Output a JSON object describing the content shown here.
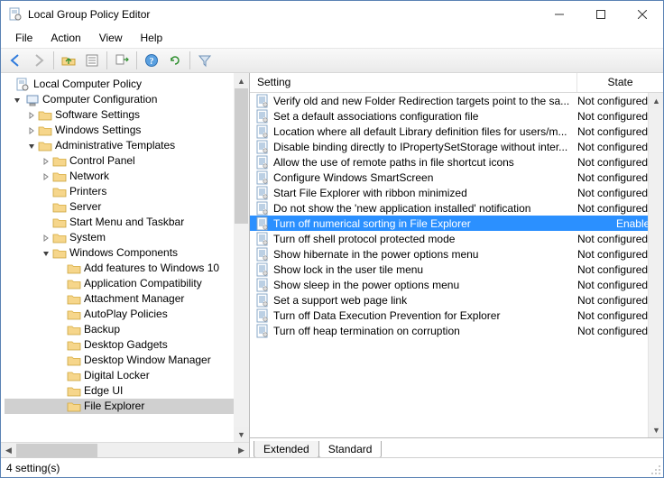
{
  "window_title": "Local Group Policy Editor",
  "menus": [
    "File",
    "Action",
    "View",
    "Help"
  ],
  "columns": {
    "setting": "Setting",
    "state": "State"
  },
  "tabs": {
    "extended": "Extended",
    "standard": "Standard"
  },
  "status": "4 setting(s)",
  "tree": {
    "root": "Local Computer Policy",
    "computer_config": "Computer Configuration",
    "software_settings": "Software Settings",
    "windows_settings": "Windows Settings",
    "admin_templates": "Administrative Templates",
    "control_panel": "Control Panel",
    "network": "Network",
    "printers": "Printers",
    "server": "Server",
    "start_menu": "Start Menu and Taskbar",
    "system": "System",
    "windows_components": "Windows Components",
    "wc": {
      "add_features": "Add features to Windows 10",
      "app_compat": "Application Compatibility",
      "attachment_mgr": "Attachment Manager",
      "autoplay": "AutoPlay Policies",
      "backup": "Backup",
      "desktop_gadgets": "Desktop Gadgets",
      "dwm": "Desktop Window Manager",
      "digital_locker": "Digital Locker",
      "edge_ui": "Edge UI",
      "file_explorer": "File Explorer"
    }
  },
  "settings": [
    {
      "name": "Verify old and new Folder Redirection targets point to the sa...",
      "state": "Not configured"
    },
    {
      "name": "Set a default associations configuration file",
      "state": "Not configured"
    },
    {
      "name": "Location where all default Library definition files for users/m...",
      "state": "Not configured"
    },
    {
      "name": "Disable binding directly to IPropertySetStorage without inter...",
      "state": "Not configured"
    },
    {
      "name": "Allow the use of remote paths in file shortcut icons",
      "state": "Not configured"
    },
    {
      "name": "Configure Windows SmartScreen",
      "state": "Not configured"
    },
    {
      "name": "Start File Explorer with ribbon minimized",
      "state": "Not configured"
    },
    {
      "name": "Do not show the 'new application installed' notification",
      "state": "Not configured"
    },
    {
      "name": "Turn off numerical sorting in File Explorer",
      "state": "Enabled",
      "selected": true
    },
    {
      "name": "Turn off shell protocol protected mode",
      "state": "Not configured"
    },
    {
      "name": "Show hibernate in the power options menu",
      "state": "Not configured"
    },
    {
      "name": "Show lock in the user tile menu",
      "state": "Not configured"
    },
    {
      "name": "Show sleep in the power options menu",
      "state": "Not configured"
    },
    {
      "name": "Set a support web page link",
      "state": "Not configured"
    },
    {
      "name": "Turn off Data Execution Prevention for Explorer",
      "state": "Not configured"
    },
    {
      "name": "Turn off heap termination on corruption",
      "state": "Not configured"
    }
  ]
}
